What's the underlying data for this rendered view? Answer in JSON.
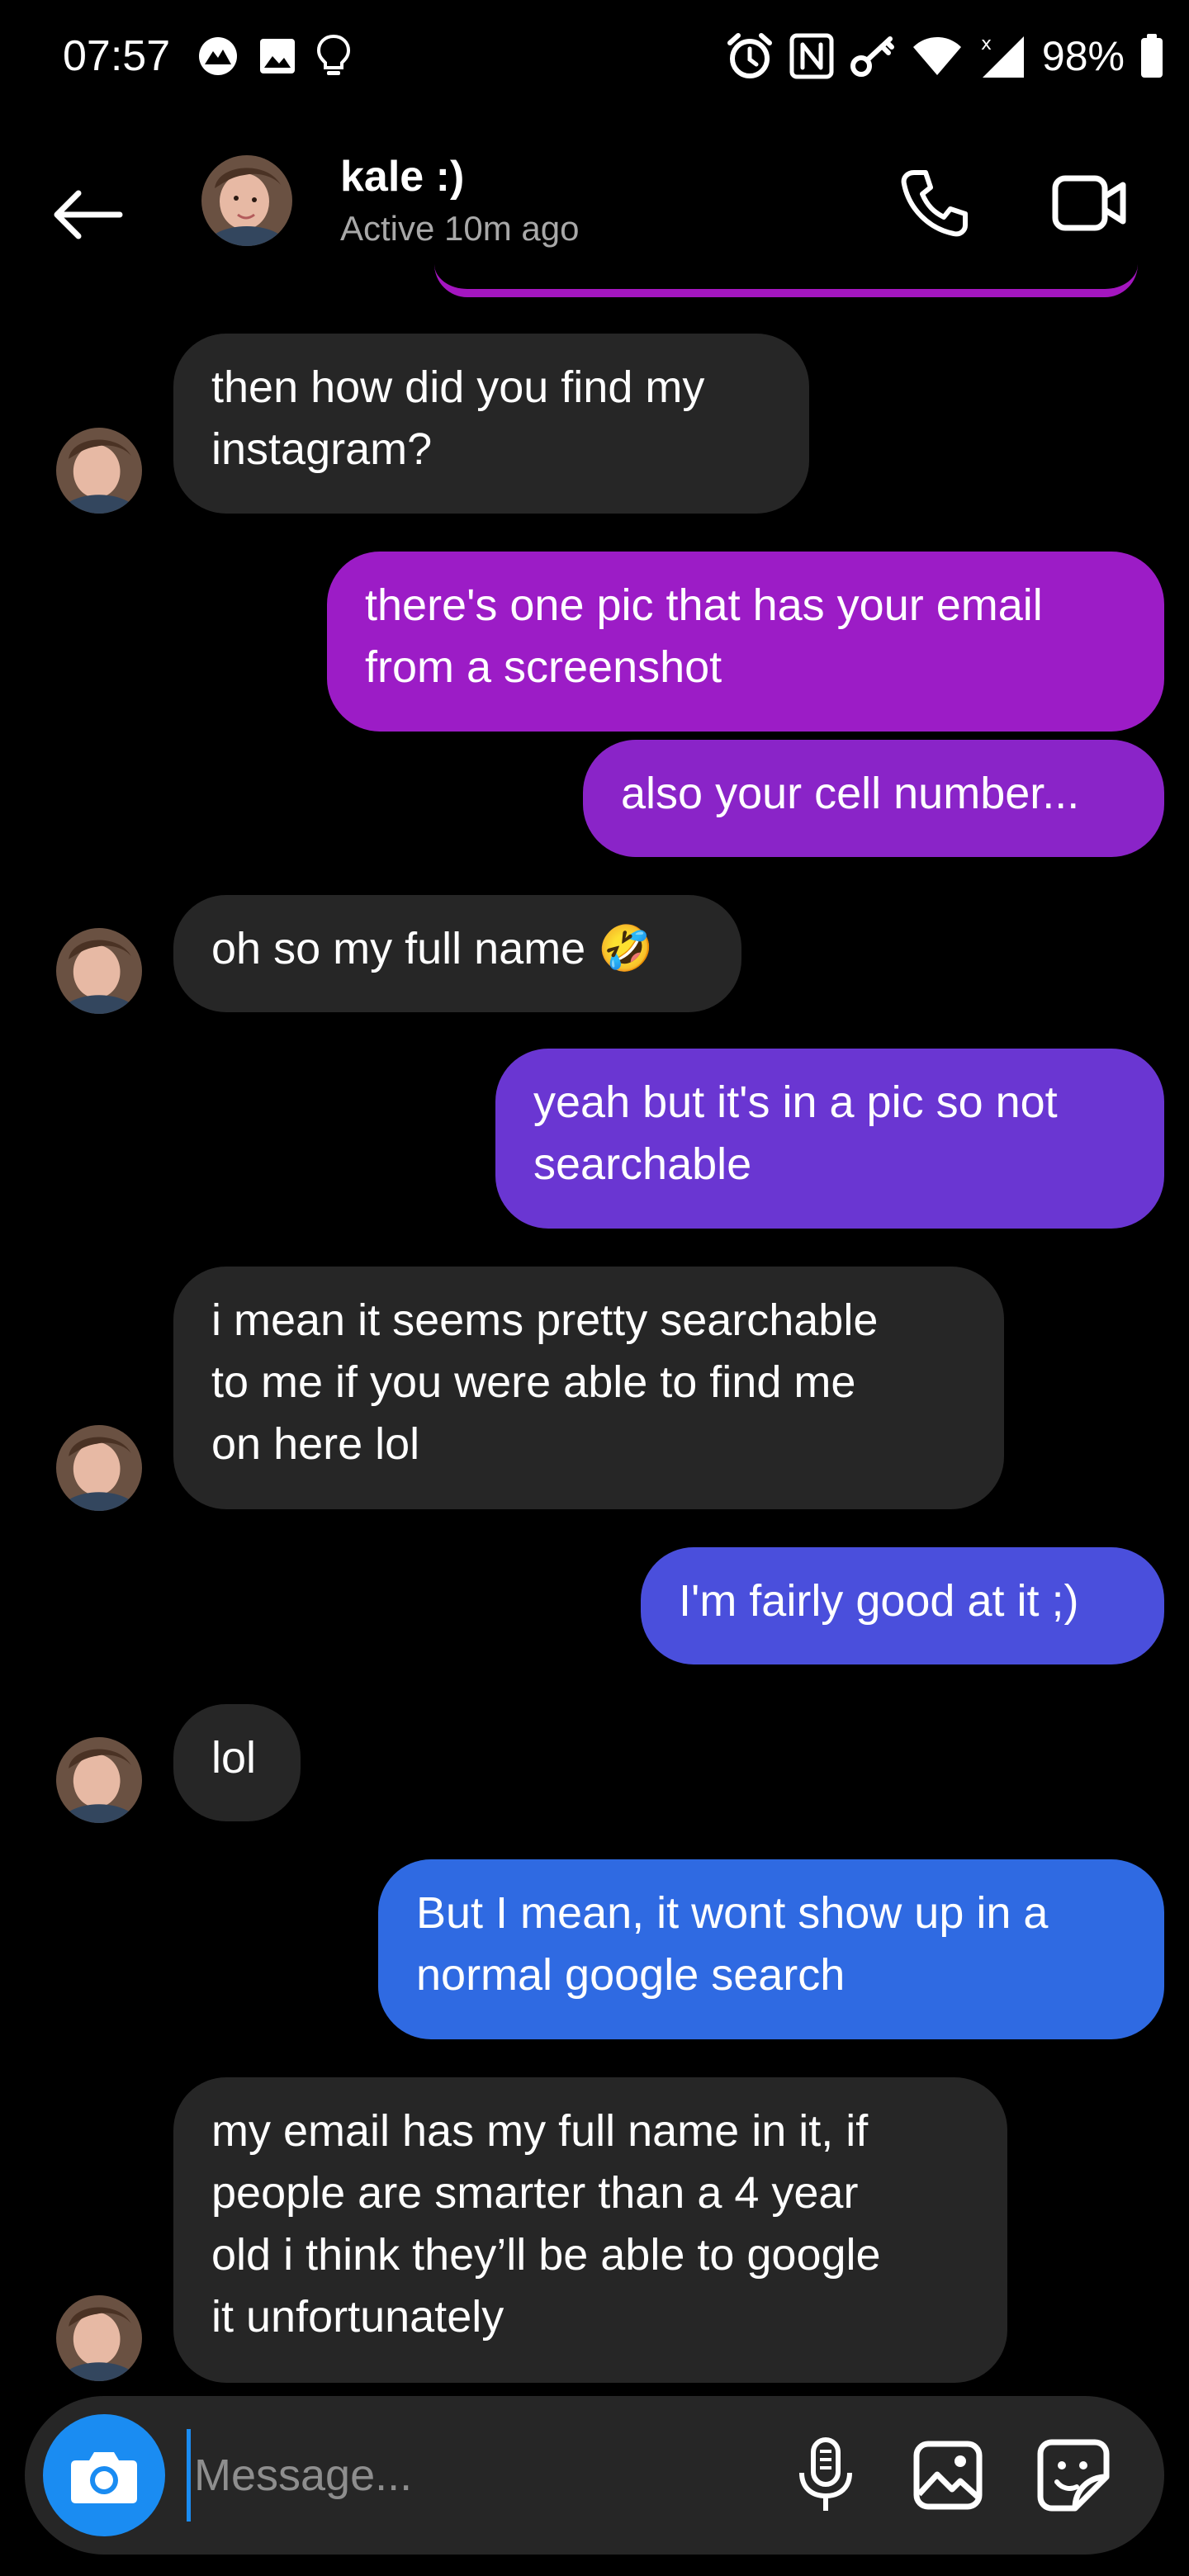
{
  "status_bar": {
    "time": "07:57",
    "battery": "98%",
    "left_icons": [
      "vpn-icon",
      "gallery-icon",
      "lightbulb-icon"
    ],
    "right_icons": [
      "alarm-icon",
      "nfc-icon",
      "key-icon",
      "wifi-icon",
      "signal-icon",
      "battery-icon"
    ]
  },
  "header": {
    "contact_name": "kale :)",
    "contact_status": "Active 10m ago",
    "icons": [
      "back-arrow-icon",
      "phone-icon",
      "video-icon"
    ]
  },
  "colors": {
    "background": "#000000",
    "incoming_bubble": "#262626",
    "outgoing_gradient_top": "#a416c0",
    "outgoing_gradient_bottom": "#2f6fe3",
    "accent": "#1a8cf2",
    "secondary_text": "#a8a8a8"
  },
  "messages": [
    {
      "sender": "them",
      "text": "then how did you find my\ninstagram?",
      "color": "#262626"
    },
    {
      "sender": "me",
      "text": "there's one pic that has your email\nfrom a screenshot",
      "color": "#9c1cc6"
    },
    {
      "sender": "me",
      "text": "also your cell number...",
      "color": "#8a24c8"
    },
    {
      "sender": "them",
      "text": "oh so my full name 🤣",
      "color": "#262626"
    },
    {
      "sender": "me",
      "text": "yeah but it's in a pic so not\nsearchable",
      "color": "#6a36d2"
    },
    {
      "sender": "them",
      "text": "i mean it seems pretty searchable\nto me if you were able to find me\non here lol",
      "color": "#262626"
    },
    {
      "sender": "me",
      "text": "I'm fairly good at it ;)",
      "color": "#4a4fdc"
    },
    {
      "sender": "them",
      "text": "lol",
      "color": "#262626"
    },
    {
      "sender": "me",
      "text": "But I mean, it wont show up in a\nnormal google search",
      "color": "#2f6ae2"
    },
    {
      "sender": "them",
      "text": "my email has my full name in it, if\npeople are smarter than a 4 year\nold i think they’ll be able to google\nit unfortunately",
      "color": "#262626"
    }
  ],
  "composer": {
    "placeholder": "Message...",
    "icons": [
      "camera-icon",
      "microphone-icon",
      "image-icon",
      "sticker-icon"
    ]
  }
}
